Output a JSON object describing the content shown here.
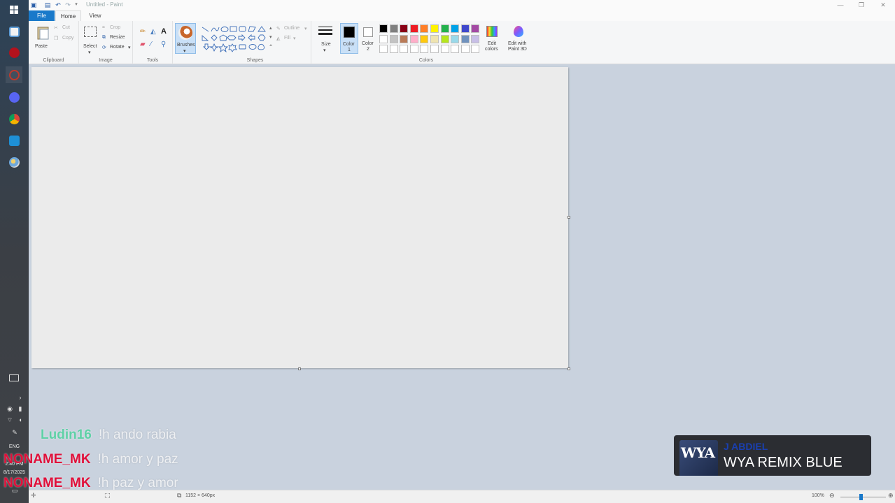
{
  "window": {
    "title": "Untitled - Paint",
    "controls": [
      "minimize",
      "restore",
      "close"
    ]
  },
  "tabs": {
    "file": "File",
    "home": "Home",
    "view": "View"
  },
  "ribbon": {
    "clipboard": {
      "label": "Clipboard",
      "paste": "Paste",
      "cut": "Cut",
      "copy": "Copy"
    },
    "image": {
      "label": "Image",
      "select": "Select",
      "crop": "Crop",
      "resize": "Resize",
      "rotate": "Rotate"
    },
    "tools": {
      "label": "Tools"
    },
    "brushes": {
      "label": "Brushes"
    },
    "shapes": {
      "label": "Shapes",
      "outline": "Outline",
      "fill": "Fill"
    },
    "size": {
      "label": "Size"
    },
    "colors": {
      "label": "Colors",
      "color1_label": "Color",
      "color1_num": "1",
      "color2_label": "Color",
      "color2_num": "2",
      "edit_colors_1": "Edit",
      "edit_colors_2": "colors",
      "paint3d_1": "Edit with",
      "paint3d_2": "Paint 3D",
      "color1_value": "#000000",
      "color2_value": "#ffffff",
      "palette_row1": [
        "#000000",
        "#7f7f7f",
        "#880015",
        "#ed1c24",
        "#ff7f27",
        "#fff200",
        "#22b14c",
        "#00a2e8",
        "#3f48cc",
        "#a349a4"
      ],
      "palette_row2": [
        "#ffffff",
        "#c3c3c3",
        "#b97a57",
        "#ffaec9",
        "#ffc90e",
        "#efe4b0",
        "#b5e61d",
        "#99d9ea",
        "#7092be",
        "#c8bfe7"
      ],
      "palette_row3": [
        "#ffffff",
        "#ffffff",
        "#ffffff",
        "#ffffff",
        "#ffffff",
        "#ffffff",
        "#ffffff",
        "#ffffff",
        "#ffffff",
        "#ffffff"
      ]
    }
  },
  "taskbar": {
    "lang": "ENG",
    "time": "2:40 PM",
    "date": "8/17/2025"
  },
  "statusbar": {
    "dimensions": "1152 × 640px",
    "zoom": "100%"
  },
  "chat": [
    {
      "user": "Ludin16",
      "message": "!h ando rabia",
      "color": "#5fd1a6"
    },
    {
      "user": "NONAME_MK",
      "message": "!h amor y paz",
      "color": "#e0103a"
    },
    {
      "user": "NONAME_MK",
      "message": "!h paz y amor",
      "color": "#e0103a"
    }
  ],
  "now_playing": {
    "art_text": "WYA",
    "artist": "J ABDIEL",
    "title": "WYA REMIX BLUE"
  }
}
